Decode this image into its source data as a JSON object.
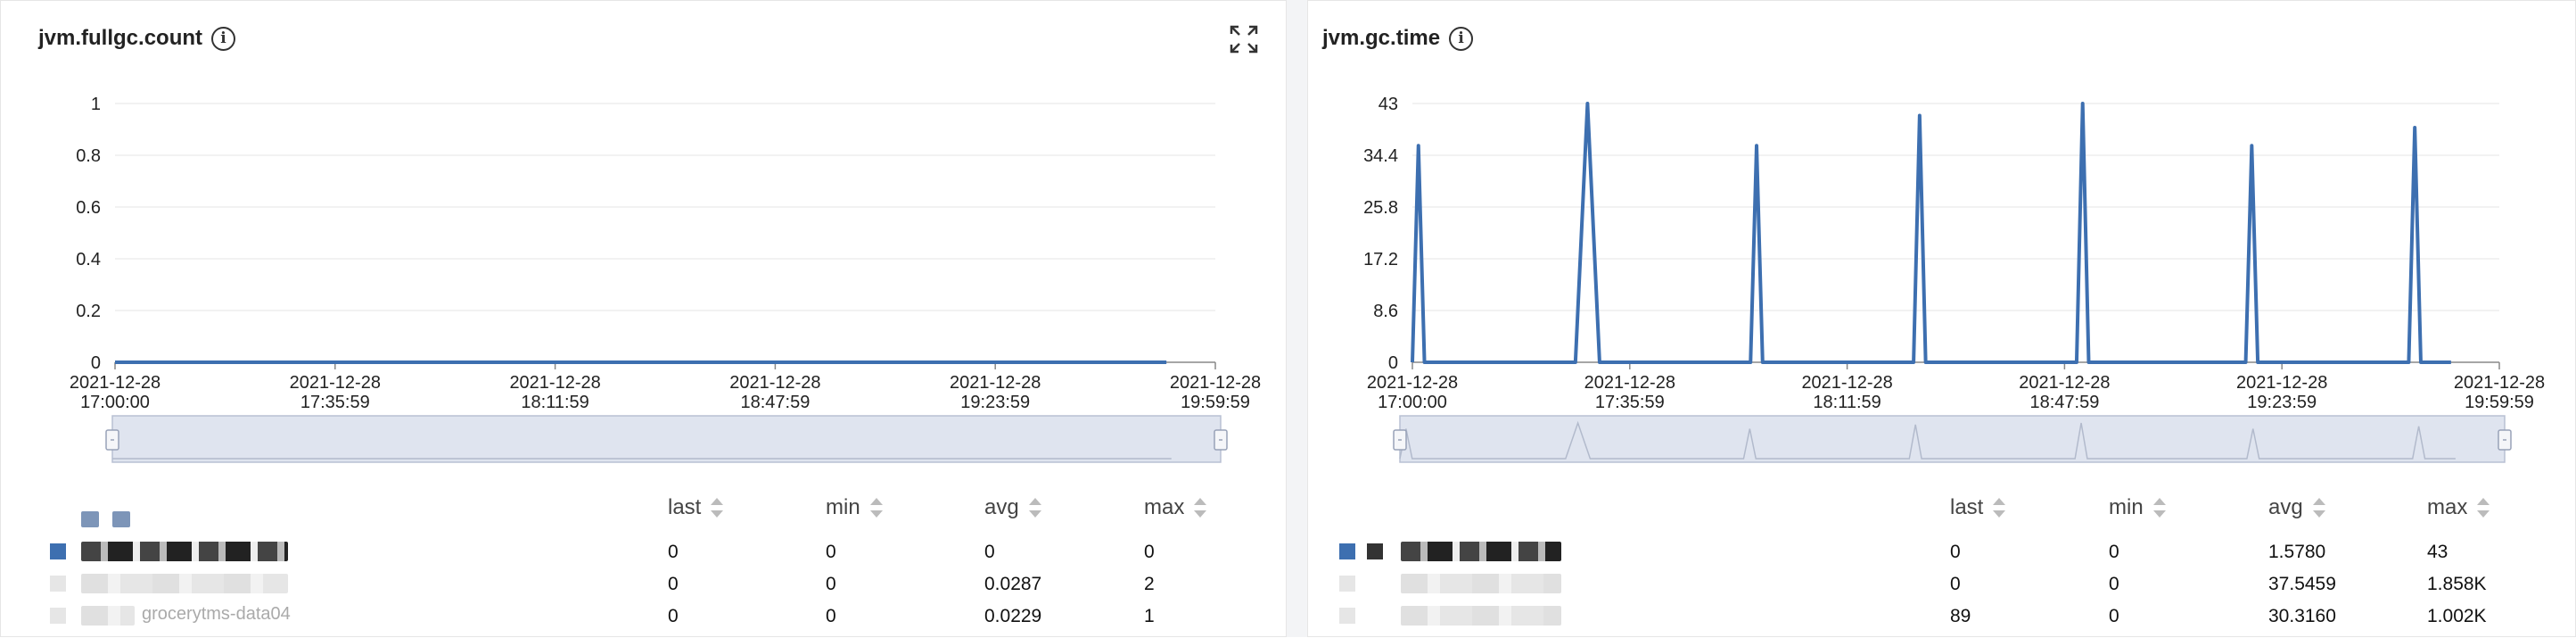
{
  "colors": {
    "series": "#3d6fb0",
    "grid": "#e5e5e5",
    "zoom_fill": "#dfe4ef",
    "zoom_border": "#b8c0d3"
  },
  "panels": [
    {
      "title": "jvm.fullgc.count",
      "info_icon": "info-icon",
      "expand_icon": "expand-icon",
      "legend": {
        "columns": [
          "last",
          "min",
          "avg",
          "max"
        ],
        "rows": [
          {
            "name": "",
            "last": "0",
            "min": "0",
            "avg": "0",
            "max": "0"
          },
          {
            "name": "",
            "last": "0",
            "min": "0",
            "avg": "0.0287",
            "max": "2"
          },
          {
            "name": "grocerytms-data04",
            "last": "0",
            "min": "0",
            "avg": "0.0229",
            "max": "1"
          }
        ]
      }
    },
    {
      "title": "jvm.gc.time",
      "info_icon": "info-icon",
      "legend": {
        "columns": [
          "last",
          "min",
          "avg",
          "max"
        ],
        "rows": [
          {
            "name": "",
            "last": "0",
            "min": "0",
            "avg": "1.5780",
            "max": "43"
          },
          {
            "name": "",
            "last": "0",
            "min": "0",
            "avg": "37.5459",
            "max": "1.858K"
          },
          {
            "name": "",
            "last": "89",
            "min": "0",
            "avg": "30.3160",
            "max": "1.002K"
          }
        ]
      }
    }
  ],
  "chart_data": [
    {
      "type": "line",
      "title": "jvm.fullgc.count",
      "y_ticks": [
        "0",
        "0.2",
        "0.4",
        "0.6",
        "0.8",
        "1"
      ],
      "ylim": [
        0,
        1
      ],
      "x_ticks": [
        [
          "2021-12-28",
          "17:00:00"
        ],
        [
          "2021-12-28",
          "17:35:59"
        ],
        [
          "2021-12-28",
          "18:11:59"
        ],
        [
          "2021-12-28",
          "18:47:59"
        ],
        [
          "2021-12-28",
          "19:23:59"
        ],
        [
          "2021-12-28",
          "19:59:59"
        ]
      ],
      "xlim_minutes_from_start": [
        0,
        180
      ],
      "grid": true,
      "series": [
        {
          "x": [
            0,
            172
          ],
          "y": [
            0,
            0
          ]
        }
      ]
    },
    {
      "type": "line",
      "title": "jvm.gc.time",
      "y_ticks": [
        "0",
        "8.6",
        "17.2",
        "25.8",
        "34.4",
        "43"
      ],
      "ylim": [
        0,
        43
      ],
      "x_ticks": [
        [
          "2021-12-28",
          "17:00:00"
        ],
        [
          "2021-12-28",
          "17:35:59"
        ],
        [
          "2021-12-28",
          "18:11:59"
        ],
        [
          "2021-12-28",
          "18:47:59"
        ],
        [
          "2021-12-28",
          "19:23:59"
        ],
        [
          "2021-12-28",
          "19:59:59"
        ]
      ],
      "xlim_minutes_from_start": [
        0,
        180
      ],
      "grid": true,
      "series": [
        {
          "x": [
            0,
            1,
            2,
            27,
            29,
            31,
            56,
            57,
            58,
            83,
            84,
            85,
            110,
            111,
            112,
            138,
            139,
            140,
            165,
            166,
            167,
            172
          ],
          "y": [
            0,
            36,
            0,
            0,
            43,
            0,
            0,
            36,
            0,
            0,
            41,
            0,
            0,
            43,
            0,
            0,
            36,
            0,
            0,
            39,
            0,
            0
          ]
        }
      ]
    }
  ]
}
